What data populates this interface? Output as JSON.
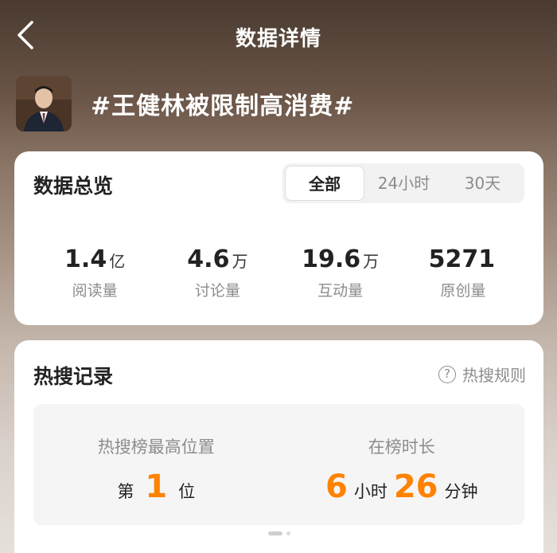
{
  "topbar": {
    "title": "数据详情"
  },
  "header": {
    "topic": "#王健林被限制高消费#"
  },
  "overview": {
    "title": "数据总览",
    "tabs": [
      {
        "label": "全部"
      },
      {
        "label": "24小时"
      },
      {
        "label": "30天"
      }
    ],
    "stats": [
      {
        "value": "1.4",
        "unit": "亿",
        "label": "阅读量"
      },
      {
        "value": "4.6",
        "unit": "万",
        "label": "讨论量"
      },
      {
        "value": "19.6",
        "unit": "万",
        "label": "互动量"
      },
      {
        "value": "5271",
        "unit": "",
        "label": "原创量"
      }
    ]
  },
  "hot_search": {
    "title": "热搜记录",
    "rules_label": "热搜规则",
    "rules_icon": "?",
    "highest": {
      "label": "热搜榜最高位置",
      "prefix": "第",
      "value": "1",
      "suffix": "位"
    },
    "duration": {
      "label": "在榜时长",
      "hours": "6",
      "hours_unit": "小时",
      "minutes": "26",
      "minutes_unit": "分钟"
    }
  },
  "colors": {
    "accent": "#ff8200"
  }
}
